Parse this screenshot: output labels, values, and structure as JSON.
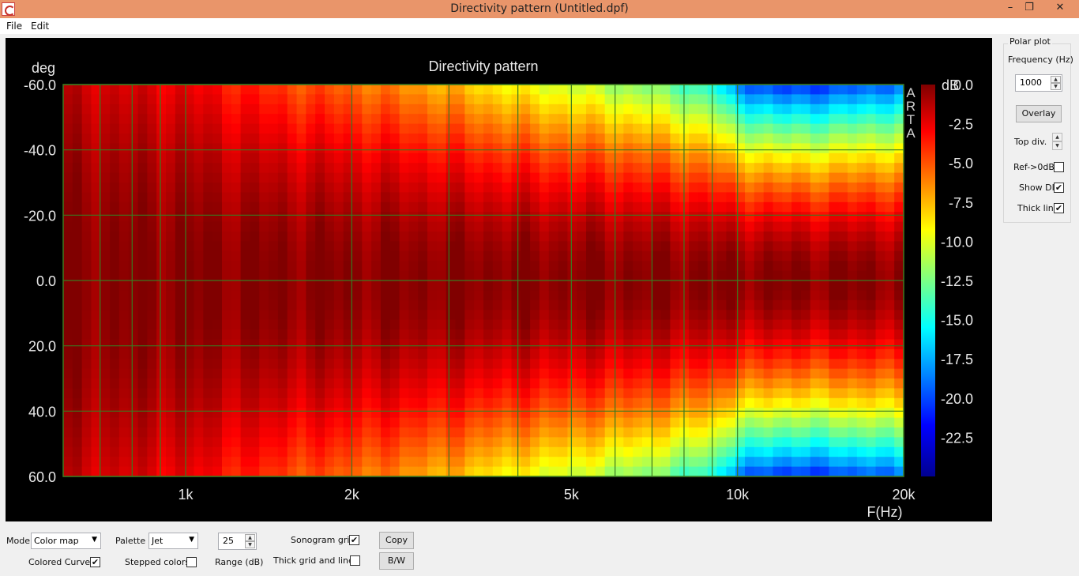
{
  "window": {
    "title": "Directivity pattern (Untitled.dpf)",
    "minimize": "–",
    "maximize": "❐",
    "close": "✕"
  },
  "menu": {
    "file": "File",
    "edit": "Edit"
  },
  "chart_data": {
    "type": "heatmap",
    "title": "Directivity pattern",
    "xlabel": "F(Hz)",
    "ylabel": "deg",
    "xscale": "log",
    "xlim": [
      600,
      20000
    ],
    "ylim": [
      -60,
      60
    ],
    "x_ticks": [
      {
        "value": 1000,
        "label": "1k"
      },
      {
        "value": 2000,
        "label": "2k"
      },
      {
        "value": 5000,
        "label": "5k"
      },
      {
        "value": 10000,
        "label": "10k"
      },
      {
        "value": 20000,
        "label": "20k"
      }
    ],
    "x_minor_grid": [
      700,
      800,
      900,
      1000,
      2000,
      3000,
      4000,
      5000,
      6000,
      7000,
      8000,
      9000,
      10000
    ],
    "y_ticks": [
      "-60.0",
      "-40.0",
      "-20.0",
      "0.0",
      "20.0",
      "40.0",
      "60.0"
    ],
    "y_tick_values": [
      -60,
      -40,
      -20,
      0,
      20,
      40,
      60
    ],
    "colorbar": {
      "label": "dB",
      "range": [
        -25,
        0
      ],
      "ticks": [
        "0.0",
        "-2.5",
        "-5.0",
        "-7.5",
        "-10.0",
        "-12.5",
        "-15.0",
        "-17.5",
        "-20.0",
        "-22.5"
      ],
      "tick_values": [
        0,
        -2.5,
        -5,
        -7.5,
        -10,
        -12.5,
        -15,
        -17.5,
        -20,
        -22.5
      ],
      "palette": "jet"
    },
    "watermark": "ARTA",
    "attenuation_db": [
      {
        "freq": 600,
        "angle_edge": -1.5
      },
      {
        "freq": 1000,
        "angle_edge": -2.5
      },
      {
        "freq": 1500,
        "angle_edge": -4.5
      },
      {
        "freq": 2000,
        "angle_edge": -5.5
      },
      {
        "freq": 3000,
        "angle_edge": -7.5
      },
      {
        "freq": 4000,
        "angle_edge": -9.5
      },
      {
        "freq": 5000,
        "angle_edge": -10.5
      },
      {
        "freq": 7000,
        "angle_edge": -12.5
      },
      {
        "freq": 9000,
        "angle_edge": -15.0
      },
      {
        "freq": 10000,
        "angle_edge": -19.0
      },
      {
        "freq": 12000,
        "angle_edge": -21.0
      },
      {
        "freq": 15000,
        "angle_edge": -20.5
      },
      {
        "freq": 20000,
        "angle_edge": -19.0
      }
    ],
    "grid": true
  },
  "polar": {
    "legend": "Polar plot",
    "frequency_label": "Frequency (Hz)",
    "frequency_value": "1000",
    "overlay_label": "Overlay",
    "top_div_label": "Top div.",
    "ref_label": "Ref->0dB",
    "ref_checked": "",
    "show_di_label": "Show DI",
    "show_di_checked": "✔",
    "thick_line_label": "Thick line",
    "thick_line_checked": "✔"
  },
  "bottom": {
    "mode_label": "Mode",
    "mode_value": "Color map",
    "palette_label": "Palette",
    "palette_value": "Jet",
    "range_value": "25",
    "range_label": "Range (dB)",
    "sonogram_grid_label": "Sonogram grid",
    "sonogram_grid_checked": "✔",
    "colored_curves_label": "Colored Curves",
    "colored_curves_checked": "✔",
    "stepped_colors_label": "Stepped colors",
    "stepped_colors_checked": "",
    "thick_grid_label": "Thick grid and  lines",
    "thick_grid_checked": "",
    "copy_label": "Copy",
    "bw_label": "B/W"
  }
}
